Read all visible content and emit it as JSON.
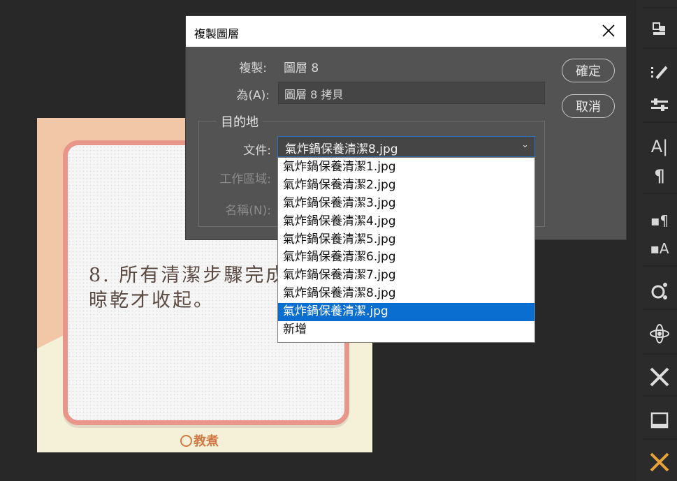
{
  "canvas": {
    "note_text": "8. 所有清潔步驟完成後\n晾乾才收起。",
    "brand_text": "教煮"
  },
  "dialog": {
    "title": "複製圖層",
    "duplicate_label": "複製:",
    "duplicate_value": "圖層 8",
    "as_label": "為(A):",
    "as_value": "圖層 8 拷貝",
    "destination_legend": "目的地",
    "document_label": "文件:",
    "artboard_label": "工作區域:",
    "name_label": "名稱(N):",
    "ok_button": "確定",
    "cancel_button": "取消"
  },
  "document_select": {
    "selected_value": "氣炸鍋保養清潔8.jpg",
    "options": [
      "氣炸鍋保養清潔1.jpg",
      "氣炸鍋保養清潔2.jpg",
      "氣炸鍋保養清潔3.jpg",
      "氣炸鍋保養清潔4.jpg",
      "氣炸鍋保養清潔5.jpg",
      "氣炸鍋保養清潔6.jpg",
      "氣炸鍋保養清潔7.jpg",
      "氣炸鍋保養清潔8.jpg",
      "氣炸鍋保養清潔.jpg",
      "新增"
    ],
    "highlighted_option": "氣炸鍋保養清潔.jpg"
  },
  "toolbar": {
    "icons": [
      "3d-icon",
      "brush-settings-icon",
      "adjustments-icon",
      "character-icon",
      "paragraph-icon",
      "paragraph-styles-icon",
      "character-styles-icon",
      "paths-icon",
      "3d-orbit-icon",
      "tools-icon",
      "frame-icon",
      "presets-icon"
    ]
  },
  "colors": {
    "highlight": "#0a6ed1",
    "dialog_bg": "#535353",
    "workspace_bg": "#282828"
  }
}
